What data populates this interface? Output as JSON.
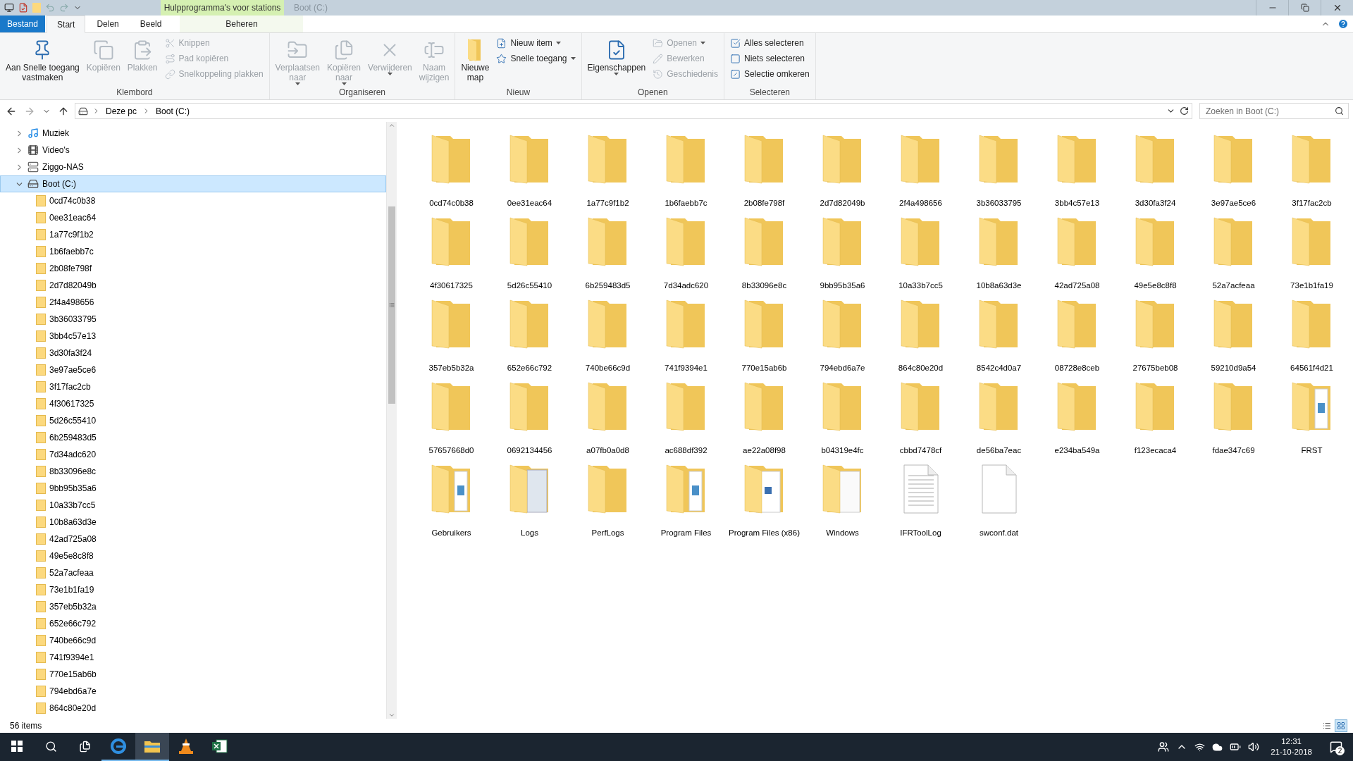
{
  "window": {
    "context_tab": "Hulpprogramma's voor stations",
    "title": "Boot (C:)"
  },
  "ribbon_tabs": [
    {
      "label": "Bestand",
      "kind": "file",
      "selected": false
    },
    {
      "label": "Start",
      "kind": "tab",
      "selected": true
    },
    {
      "label": "Delen",
      "kind": "tab",
      "selected": false
    },
    {
      "label": "Beeld",
      "kind": "tab",
      "selected": false
    },
    {
      "label": "Beheren",
      "kind": "context",
      "selected": false
    }
  ],
  "ribbon_groups": [
    {
      "label": "Klembord",
      "items": [
        {
          "kind": "large",
          "lines": [
            "Aan Snelle toegang",
            "vastmaken"
          ],
          "disabled": false,
          "dropdown": false
        },
        {
          "kind": "large",
          "lines": [
            "Kopiëren"
          ],
          "disabled": true,
          "dropdown": false
        },
        {
          "kind": "large",
          "lines": [
            "Plakken"
          ],
          "disabled": true,
          "dropdown": false
        },
        {
          "kind": "small",
          "lines": [
            "Knippen"
          ],
          "disabled": true,
          "dropdown": false
        },
        {
          "kind": "small",
          "lines": [
            "Pad kopiëren"
          ],
          "disabled": true,
          "dropdown": false
        },
        {
          "kind": "small",
          "lines": [
            "Snelkoppeling plakken"
          ],
          "disabled": true,
          "dropdown": false
        }
      ]
    },
    {
      "label": "Organiseren",
      "items": [
        {
          "kind": "large",
          "lines": [
            "Verplaatsen",
            "naar"
          ],
          "disabled": true,
          "dropdown": true
        },
        {
          "kind": "large",
          "lines": [
            "Kopiëren",
            "naar"
          ],
          "disabled": true,
          "dropdown": true
        },
        {
          "kind": "large",
          "lines": [
            "Verwijderen"
          ],
          "disabled": true,
          "dropdown": true
        },
        {
          "kind": "large",
          "lines": [
            "Naam",
            "wijzigen"
          ],
          "disabled": true,
          "dropdown": false
        }
      ]
    },
    {
      "label": "Nieuw",
      "items": [
        {
          "kind": "large",
          "lines": [
            "Nieuwe",
            "map"
          ],
          "disabled": false,
          "dropdown": false
        },
        {
          "kind": "small",
          "lines": [
            "Nieuw item"
          ],
          "disabled": false,
          "dropdown": true
        },
        {
          "kind": "small",
          "lines": [
            "Snelle toegang"
          ],
          "disabled": false,
          "dropdown": true
        }
      ]
    },
    {
      "label": "Openen",
      "items": [
        {
          "kind": "large",
          "lines": [
            "Eigenschappen"
          ],
          "disabled": false,
          "dropdown": true
        },
        {
          "kind": "small",
          "lines": [
            "Openen"
          ],
          "disabled": true,
          "dropdown": true
        },
        {
          "kind": "small",
          "lines": [
            "Bewerken"
          ],
          "disabled": true,
          "dropdown": false
        },
        {
          "kind": "small",
          "lines": [
            "Geschiedenis"
          ],
          "disabled": true,
          "dropdown": false
        }
      ]
    },
    {
      "label": "Selecteren",
      "items": [
        {
          "kind": "small",
          "lines": [
            "Alles selecteren"
          ],
          "disabled": false,
          "dropdown": false
        },
        {
          "kind": "small",
          "lines": [
            "Niets selecteren"
          ],
          "disabled": false,
          "dropdown": false
        },
        {
          "kind": "small",
          "lines": [
            "Selectie omkeren"
          ],
          "disabled": false,
          "dropdown": false
        }
      ]
    }
  ],
  "address_bar": {
    "crumbs": [
      "Deze pc",
      "Boot (C:)"
    ]
  },
  "search": {
    "placeholder": "Zoeken in Boot (C:)"
  },
  "tree": [
    {
      "label": "Muziek",
      "kind": "music",
      "expanded": false,
      "selected": false
    },
    {
      "label": "Video's",
      "kind": "video",
      "expanded": false,
      "selected": false
    },
    {
      "label": "Ziggo-NAS",
      "kind": "network",
      "expanded": false,
      "selected": false
    },
    {
      "label": "Boot (C:)",
      "kind": "drive",
      "expanded": true,
      "selected": true,
      "children": [
        {
          "label": "0cd74c0b38",
          "selected": false
        },
        {
          "label": "0ee31eac64",
          "selected": false
        },
        {
          "label": "1a77c9f1b2",
          "selected": false
        },
        {
          "label": "1b6faebb7c",
          "selected": false
        },
        {
          "label": "2b08fe798f",
          "selected": false
        },
        {
          "label": "2d7d82049b",
          "selected": false
        },
        {
          "label": "2f4a498656",
          "selected": false
        },
        {
          "label": "3b36033795",
          "selected": false
        },
        {
          "label": "3bb4c57e13",
          "selected": false
        },
        {
          "label": "3d30fa3f24",
          "selected": false
        },
        {
          "label": "3e97ae5ce6",
          "selected": false
        },
        {
          "label": "3f17fac2cb",
          "selected": false
        },
        {
          "label": "4f30617325",
          "selected": false
        },
        {
          "label": "5d26c55410",
          "selected": false
        },
        {
          "label": "6b259483d5",
          "selected": false
        },
        {
          "label": "7d34adc620",
          "selected": false
        },
        {
          "label": "8b33096e8c",
          "selected": false
        },
        {
          "label": "9bb95b35a6",
          "selected": false
        },
        {
          "label": "10a33b7cc5",
          "selected": false
        },
        {
          "label": "10b8a63d3e",
          "selected": false
        },
        {
          "label": "42ad725a08",
          "selected": false
        },
        {
          "label": "49e5e8c8f8",
          "selected": false
        },
        {
          "label": "52a7acfeaa",
          "selected": false
        },
        {
          "label": "73e1b1fa19",
          "selected": false
        },
        {
          "label": "357eb5b32a",
          "selected": false
        },
        {
          "label": "652e66c792",
          "selected": false
        },
        {
          "label": "740be66c9d",
          "selected": false
        },
        {
          "label": "741f9394e1",
          "selected": false
        },
        {
          "label": "770e15ab6b",
          "selected": false
        },
        {
          "label": "794ebd6a7e",
          "selected": false
        },
        {
          "label": "864c80e20d",
          "selected": false
        }
      ]
    }
  ],
  "files": [
    {
      "name": "0cd74c0b38",
      "kind": "folder"
    },
    {
      "name": "0ee31eac64",
      "kind": "folder"
    },
    {
      "name": "1a77c9f1b2",
      "kind": "folder"
    },
    {
      "name": "1b6faebb7c",
      "kind": "folder"
    },
    {
      "name": "2b08fe798f",
      "kind": "folder"
    },
    {
      "name": "2d7d82049b",
      "kind": "folder"
    },
    {
      "name": "2f4a498656",
      "kind": "folder"
    },
    {
      "name": "3b36033795",
      "kind": "folder"
    },
    {
      "name": "3bb4c57e13",
      "kind": "folder"
    },
    {
      "name": "3d30fa3f24",
      "kind": "folder"
    },
    {
      "name": "3e97ae5ce6",
      "kind": "folder"
    },
    {
      "name": "3f17fac2cb",
      "kind": "folder"
    },
    {
      "name": "4f30617325",
      "kind": "folder"
    },
    {
      "name": "5d26c55410",
      "kind": "folder"
    },
    {
      "name": "6b259483d5",
      "kind": "folder"
    },
    {
      "name": "7d34adc620",
      "kind": "folder"
    },
    {
      "name": "8b33096e8c",
      "kind": "folder"
    },
    {
      "name": "9bb95b35a6",
      "kind": "folder"
    },
    {
      "name": "10a33b7cc5",
      "kind": "folder"
    },
    {
      "name": "10b8a63d3e",
      "kind": "folder"
    },
    {
      "name": "42ad725a08",
      "kind": "folder"
    },
    {
      "name": "49e5e8c8f8",
      "kind": "folder"
    },
    {
      "name": "52a7acfeaa",
      "kind": "folder"
    },
    {
      "name": "73e1b1fa19",
      "kind": "folder"
    },
    {
      "name": "357eb5b32a",
      "kind": "folder"
    },
    {
      "name": "652e66c792",
      "kind": "folder"
    },
    {
      "name": "740be66c9d",
      "kind": "folder"
    },
    {
      "name": "741f9394e1",
      "kind": "folder"
    },
    {
      "name": "770e15ab6b",
      "kind": "folder"
    },
    {
      "name": "794ebd6a7e",
      "kind": "folder"
    },
    {
      "name": "864c80e20d",
      "kind": "folder"
    },
    {
      "name": "8542c4d0a7",
      "kind": "folder"
    },
    {
      "name": "08728e8ceb",
      "kind": "folder"
    },
    {
      "name": "27675beb08",
      "kind": "folder"
    },
    {
      "name": "59210d9a54",
      "kind": "folder"
    },
    {
      "name": "64561f4d21",
      "kind": "folder"
    },
    {
      "name": "57657668d0",
      "kind": "folder"
    },
    {
      "name": "0692134456",
      "kind": "folder"
    },
    {
      "name": "a07fb0a0d8",
      "kind": "folder"
    },
    {
      "name": "ac688df392",
      "kind": "folder"
    },
    {
      "name": "ae22a08f98",
      "kind": "folder"
    },
    {
      "name": "b04319e4fc",
      "kind": "folder"
    },
    {
      "name": "cbbd7478cf",
      "kind": "folder"
    },
    {
      "name": "de56ba7eac",
      "kind": "folder"
    },
    {
      "name": "e234ba549a",
      "kind": "folder"
    },
    {
      "name": "f123ecaca4",
      "kind": "folder"
    },
    {
      "name": "fdae347c69",
      "kind": "folder"
    },
    {
      "name": "FRST",
      "kind": "folder-documents"
    },
    {
      "name": "Gebruikers",
      "kind": "folder-documents"
    },
    {
      "name": "Logs",
      "kind": "folder-badge"
    },
    {
      "name": "PerfLogs",
      "kind": "folder"
    },
    {
      "name": "Program Files",
      "kind": "folder-documents"
    },
    {
      "name": "Program Files (x86)",
      "kind": "folder-picture"
    },
    {
      "name": "Windows",
      "kind": "folder-pages"
    },
    {
      "name": "IFRToolLog",
      "kind": "text-file"
    },
    {
      "name": "swconf.dat",
      "kind": "file"
    }
  ],
  "status_bar": {
    "count": "56 items",
    "view_modes": [
      {
        "kind": "details",
        "selected": false
      },
      {
        "kind": "large-icons",
        "selected": true
      }
    ]
  },
  "taskbar": {
    "apps": [
      {
        "kind": "browser",
        "running": true,
        "active": false
      },
      {
        "kind": "files",
        "running": true,
        "active": true
      },
      {
        "kind": "media-player",
        "running": false,
        "active": false
      },
      {
        "kind": "spreadsheet",
        "running": false,
        "active": false
      }
    ],
    "time": "12:31",
    "date": "21-10-2018",
    "notifications": "2"
  }
}
